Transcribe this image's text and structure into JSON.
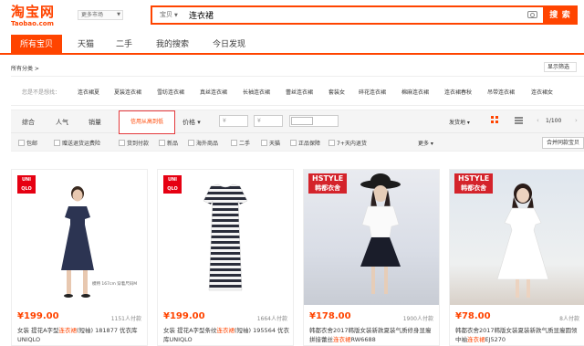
{
  "header": {
    "logo_cn": "淘宝网",
    "logo_en": "Taobao.com",
    "market_label": "更多市场",
    "search_tab": "宝贝",
    "search_value": "连衣裙",
    "search_button": "搜 索"
  },
  "main_nav": [
    "所有宝贝",
    "天猫",
    "二手",
    "我的搜索",
    "今日发现"
  ],
  "category": {
    "label": "所有分类 >",
    "display_filter": "显示筛选"
  },
  "suggestions": {
    "label": "您是不是想找：",
    "items": [
      "连衣裙夏",
      "夏装连衣裙",
      "雪纺连衣裙",
      "真丝连衣裙",
      "长袖连衣裙",
      "蕾丝连衣裙",
      "套装女",
      "碎花连衣裙",
      "棉麻连衣裙",
      "连衣裙春秋",
      "吊带连衣裙",
      "连衣裙女"
    ]
  },
  "sort": {
    "items": [
      "综合",
      "人气",
      "销量"
    ],
    "highlight": "信用从高到低",
    "price_label": "价格",
    "price_min": "¥",
    "price_max": "¥",
    "ship_from": "发货地",
    "page": "1/100"
  },
  "checkboxes": [
    "包邮",
    "赠送退货运费险",
    "货到付款",
    "新品",
    "海外商品",
    "二手",
    "天猫",
    "正品保障",
    "7+天内退货"
  ],
  "more_label": "更多",
  "merge_button": "合并同款宝贝",
  "products": [
    {
      "price": "¥199.00",
      "sales": "1151人付款",
      "title_pre": "女装 提花A字型",
      "title_hl": "连衣裙",
      "title_post": "(短袖) 181877 优衣库UNIQLO",
      "badge": "UNI QLO",
      "note": "模特 167cm 穿着尺码M"
    },
    {
      "price": "¥199.00",
      "sales": "1664人付款",
      "title_pre": "女装 提花A字型条纹",
      "title_hl": "连衣裙",
      "title_post": "(短袖) 195564 优衣库UNIQLO",
      "badge": "UNI QLO"
    },
    {
      "price": "¥178.00",
      "sales": "1900人付款",
      "title_pre": "韩都衣舍2017韩版女装新款夏装气质修身显瘦拼接蕾丝",
      "title_hl": "连衣裙",
      "title_post": "RW6688",
      "badge_top": "HSTYLE",
      "badge_bottom": "韩都衣舍"
    },
    {
      "price": "¥78.00",
      "sales": "8人付款",
      "title_pre": "韩都衣舍2017韩版女装夏装新款气质显瘦圆领中袖",
      "title_hl": "连衣裙",
      "title_post": "EJ5270",
      "badge_top": "HSTYLE",
      "badge_bottom": "韩都衣舍"
    }
  ],
  "colors": {
    "brand": "#ff4400",
    "uniqlo_red": "#e60012",
    "hstyle_red": "#d4232b"
  }
}
